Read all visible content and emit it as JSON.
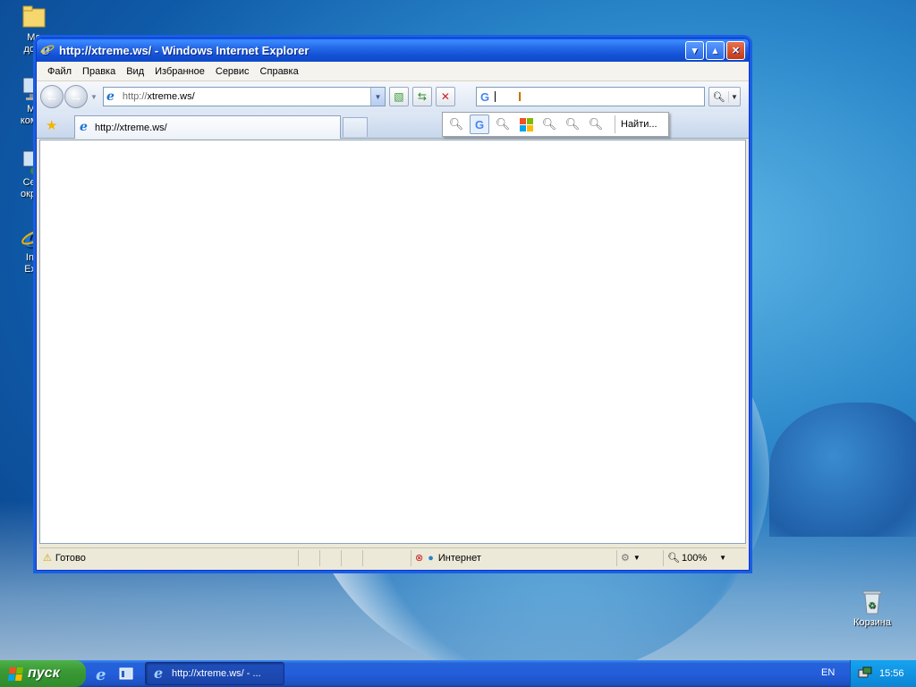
{
  "desktop": {
    "icons": [
      {
        "label": "Мо\nдоку"
      },
      {
        "label": "Мо\nкомпь"
      },
      {
        "label": "Сете\nокруж"
      },
      {
        "label": "Inte\nExpl"
      }
    ],
    "recycle_bin": "Корзина"
  },
  "window": {
    "title": "http://xtreme.ws/ - Windows Internet Explorer",
    "menu": [
      "Файл",
      "Правка",
      "Вид",
      "Избранное",
      "Сервис",
      "Справка"
    ],
    "address_prefix": "http://",
    "address_host": "xtreme.ws/",
    "tab_label": "http://xtreme.ws/",
    "search_value": "",
    "search_dropdown_find": "Найти...",
    "status": {
      "text": "Готово",
      "zone": "Интернет",
      "zoom": "100%"
    }
  },
  "taskbar": {
    "start_label": "пуск",
    "task_label": "http://xtreme.ws/ - ...",
    "lang": "EN",
    "clock": "15:56"
  }
}
